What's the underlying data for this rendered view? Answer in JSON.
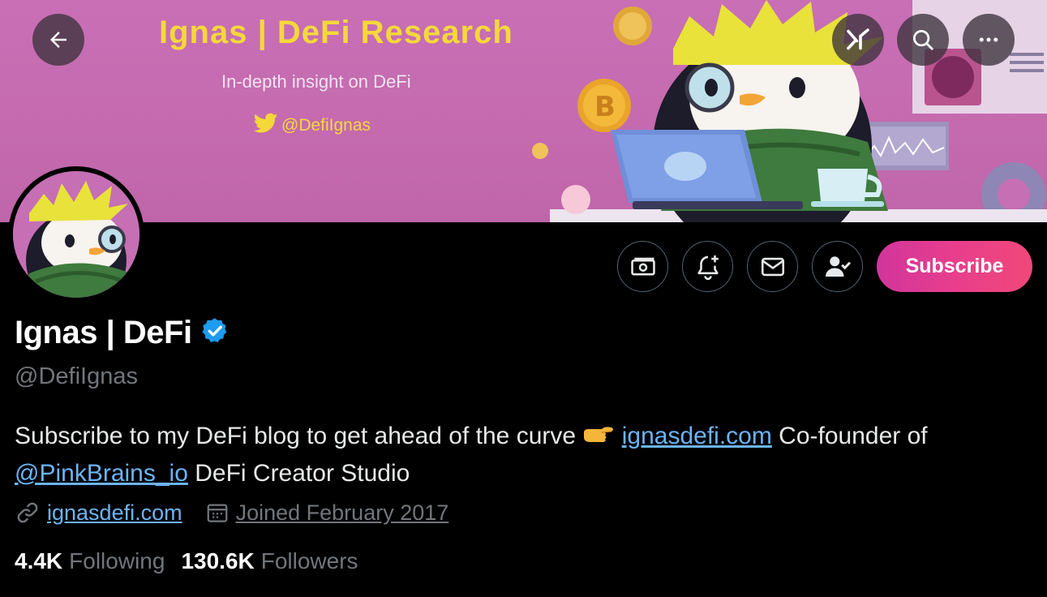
{
  "banner": {
    "title": "Ignas  |  DeFi Research",
    "subtitle": "In-depth insight on DeFi",
    "handle": "@DefiIgnas"
  },
  "nav": {
    "back_icon": "arrow-left-icon",
    "grok_icon": "grok-icon",
    "search_icon": "search-icon",
    "more_icon": "more-icon"
  },
  "actions": {
    "tips_icon": "money-icon",
    "notify_icon": "bell-plus-icon",
    "message_icon": "envelope-icon",
    "follow_icon": "person-check-icon",
    "subscribe_label": "Subscribe"
  },
  "profile": {
    "display_name": "Ignas | DeFi",
    "handle": "@DefiIgnas",
    "bio_part1": "Subscribe to my DeFi blog to get ahead of the curve ",
    "bio_link1": "ignasdefi.com",
    "bio_part2": " Co-founder of ",
    "bio_link2": "@PinkBrains_io",
    "bio_part3": " DeFi Creator Studio",
    "website": "ignasdefi.com",
    "joined": "Joined February 2017"
  },
  "stats": {
    "following_count": "4.4K",
    "following_label": "Following",
    "followers_count": "130.6K",
    "followers_label": "Followers"
  },
  "colors": {
    "accent": "#1d9bf0",
    "link": "#6cb4f4",
    "banner_pink": "#c66fb4",
    "banner_yellow": "#f4d83a",
    "subscribe_gradient_start": "#d1359c",
    "subscribe_gradient_end": "#f0487a",
    "muted": "#71767b"
  }
}
